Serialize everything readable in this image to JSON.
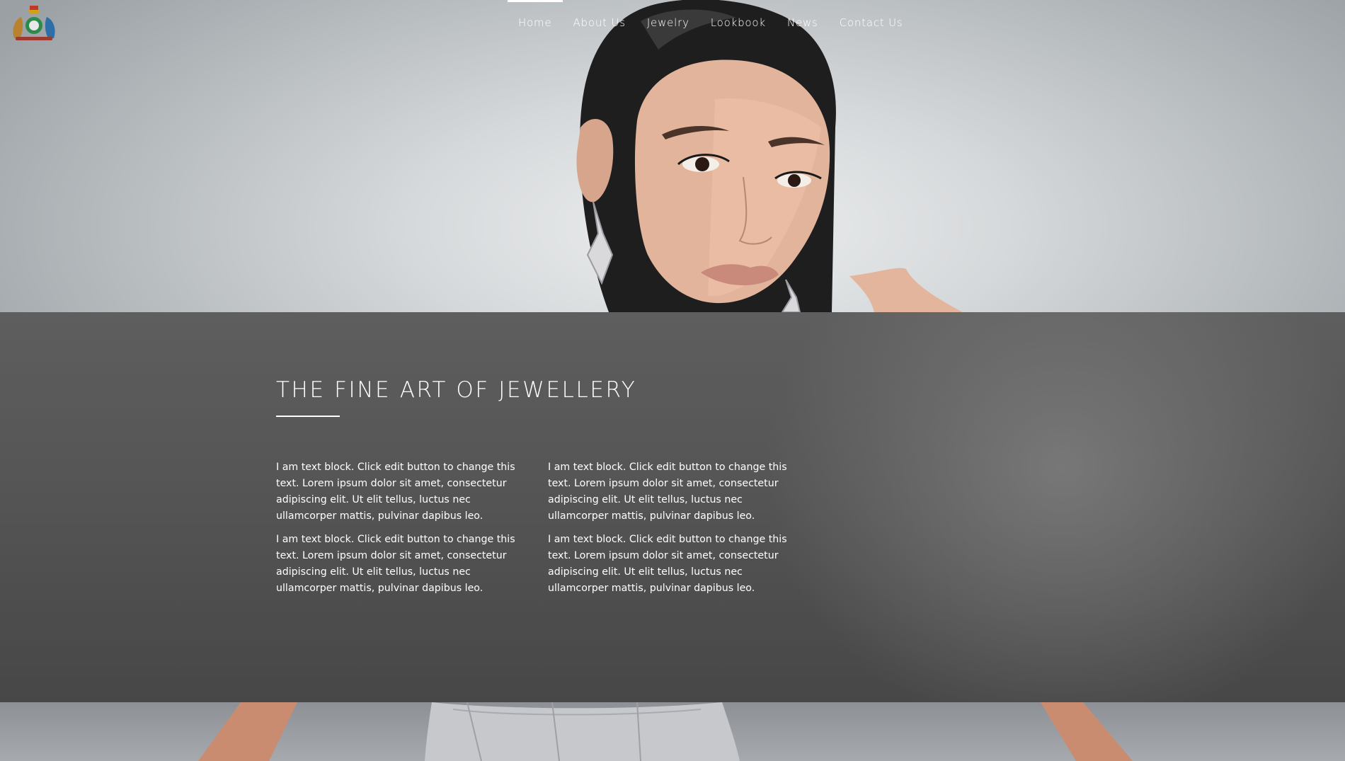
{
  "brand": {
    "logo_icon": "royal-crest-logo"
  },
  "nav": {
    "items": [
      {
        "label": "Home",
        "active": true
      },
      {
        "label": "About Us",
        "active": false
      },
      {
        "label": "Jewelry",
        "active": false
      },
      {
        "label": "Lookbook",
        "active": false
      },
      {
        "label": "News",
        "active": false
      },
      {
        "label": "Contact Us",
        "active": false
      }
    ]
  },
  "section": {
    "title": "THE FINE ART OF JEWELLERY",
    "columns": [
      {
        "paragraphs": [
          "I am text block. Click edit button to change this text. Lorem ipsum dolor sit amet, consectetur adipiscing elit. Ut elit tellus, luctus nec ullamcorper mattis, pulvinar dapibus leo.",
          "I am text block. Click edit button to change this text. Lorem ipsum dolor sit amet, consectetur adipiscing elit. Ut elit tellus, luctus nec ullamcorper mattis, pulvinar dapibus leo."
        ]
      },
      {
        "paragraphs": [
          "I am text block. Click edit button to change this text. Lorem ipsum dolor sit amet, consectetur adipiscing elit. Ut elit tellus, luctus nec ullamcorper mattis, pulvinar dapibus leo.",
          "I am text block. Click edit button to change this text. Lorem ipsum dolor sit amet, consectetur adipiscing elit. Ut elit tellus, luctus nec ullamcorper mattis, pulvinar dapibus leo."
        ]
      }
    ]
  },
  "colors": {
    "band": "#555555",
    "text": "#ffffff",
    "hero_bg": "#d6d9db"
  }
}
